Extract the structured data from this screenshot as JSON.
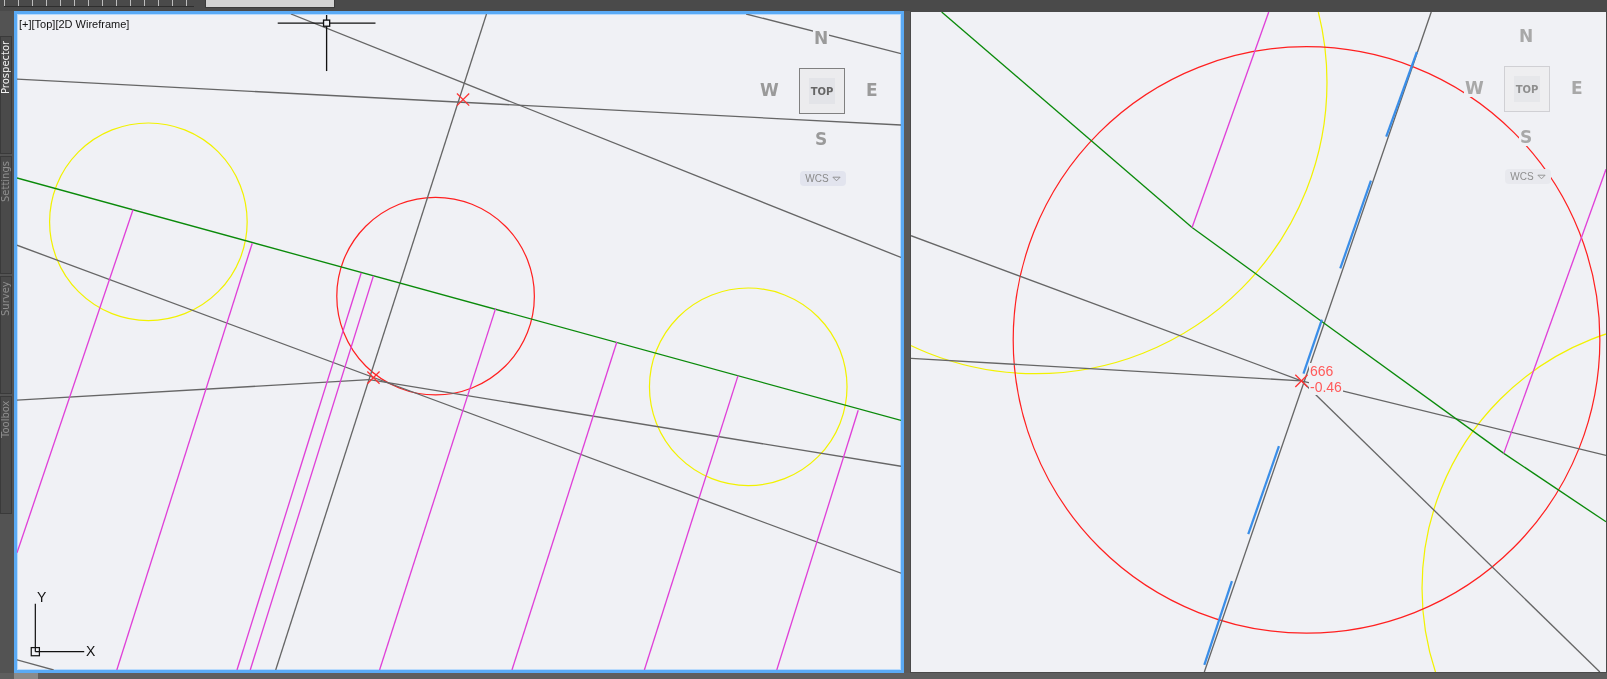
{
  "palette_tabs": [
    {
      "label": "Prospector",
      "selected": true
    },
    {
      "label": "Settings",
      "selected": false
    },
    {
      "label": "Survey",
      "selected": false
    },
    {
      "label": "Toolbox",
      "selected": false
    }
  ],
  "viewports": [
    {
      "label": "[+][Top][2D Wireframe]",
      "selected": true,
      "viewcube": {
        "north": "N",
        "west": "W",
        "face": "TOP",
        "east": "E",
        "south": "S",
        "ucs": "WCS"
      },
      "axes": {
        "y": "Y",
        "x": "X"
      }
    },
    {
      "selected": false,
      "viewcube": {
        "north": "N",
        "west": "W",
        "face": "TOP",
        "east": "E",
        "south": "S",
        "ucs": "WCS"
      },
      "readout": [
        "666",
        "-0.46"
      ]
    }
  ]
}
